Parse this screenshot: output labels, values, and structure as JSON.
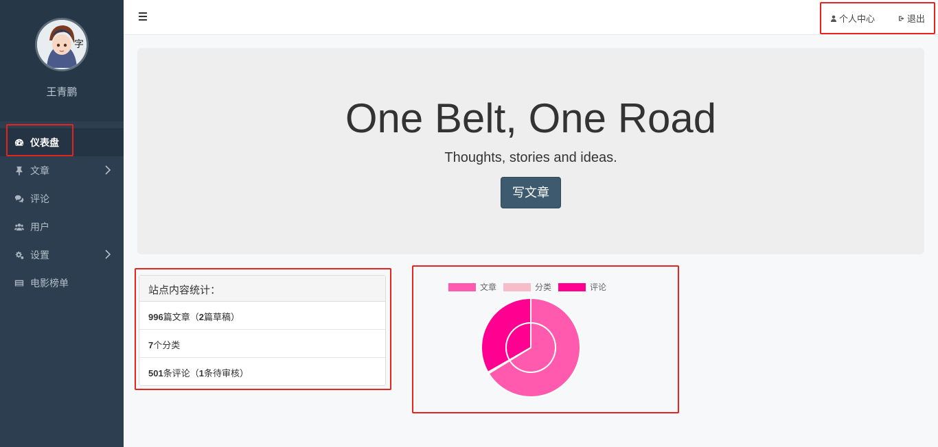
{
  "sidebar": {
    "username": "王青鹏",
    "items": [
      {
        "label": "仪表盘",
        "icon": "dashboard-icon",
        "active": true,
        "has_children": false
      },
      {
        "label": "文章",
        "icon": "thumbtack-icon",
        "active": false,
        "has_children": true
      },
      {
        "label": "评论",
        "icon": "comments-icon",
        "active": false,
        "has_children": false
      },
      {
        "label": "用户",
        "icon": "users-icon",
        "active": false,
        "has_children": false
      },
      {
        "label": "设置",
        "icon": "cogs-icon",
        "active": false,
        "has_children": true
      },
      {
        "label": "电影榜单",
        "icon": "list-icon",
        "active": false,
        "has_children": false
      }
    ]
  },
  "topbar": {
    "profile_label": "个人中心",
    "logout_label": "退出"
  },
  "jumbotron": {
    "title": "One Belt, One Road",
    "subtitle": "Thoughts, stories and ideas.",
    "button_label": "写文章"
  },
  "stats": {
    "heading": "站点内容统计：",
    "posts_count": "996",
    "posts_text": "篇文章（",
    "drafts_count": "2",
    "drafts_text": "篇草稿）",
    "categories_count": "7",
    "categories_text": "个分类",
    "comments_count": "501",
    "comments_text": "条评论（",
    "pending_count": "1",
    "pending_text": "条待审核）"
  },
  "colors": {
    "sidebar_bg": "#2c3e50",
    "accent": "#3e5a6e",
    "annotation_red": "#e8231e"
  },
  "chart_data": {
    "type": "pie",
    "variant": "doughnut-with-inner-ring",
    "legend": [
      {
        "name": "文章",
        "color": "#ff5aae"
      },
      {
        "name": "分类",
        "color": "#f6bcc8"
      },
      {
        "name": "评论",
        "color": "#ff0090"
      }
    ],
    "outer_ring": [
      {
        "name": "文章",
        "value": 996,
        "color": "#ff5aae"
      },
      {
        "name": "分类",
        "value": 7,
        "color": "#f6bcc8"
      },
      {
        "name": "评论",
        "value": 501,
        "color": "#ff0090"
      }
    ],
    "legend_position": "top"
  }
}
